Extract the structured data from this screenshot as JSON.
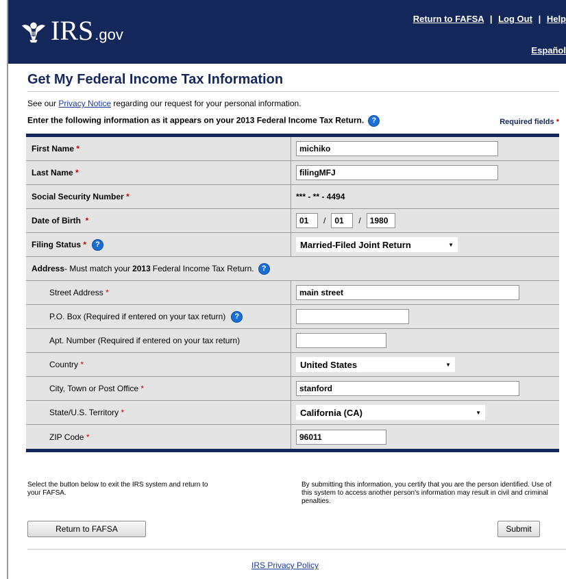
{
  "header": {
    "logo_text": "IRS",
    "logo_suffix": ".gov",
    "links": [
      "Return to FAFSA",
      "Log Out",
      "Help"
    ],
    "espanol": "Español"
  },
  "page": {
    "title": "Get My Federal Income Tax Information",
    "privacy_prefix": "See our ",
    "privacy_link": "Privacy Notice",
    "privacy_suffix": " regarding our request for your personal information.",
    "instruction": "Enter the following information as it appears on your 2013 Federal Income Tax Return.",
    "required_fields": "Required fields",
    "required_marker": "*"
  },
  "form": {
    "first_name": {
      "label": "First Name",
      "value": "michiko"
    },
    "last_name": {
      "label": "Last Name",
      "value": "filingMFJ"
    },
    "ssn": {
      "label": "Social Security Number",
      "value": "*** - ** - 4494"
    },
    "dob": {
      "label": "Date of Birth",
      "month": "01",
      "day": "01",
      "year": "1980",
      "sep": "/"
    },
    "filing_status": {
      "label": "Filing Status",
      "value": "Married-Filed Joint Return"
    },
    "address_header": {
      "label": "Address",
      "middle": " - Must match your ",
      "year": "2013",
      "rest": " Federal Income Tax Return."
    },
    "street": {
      "label": "Street Address",
      "value": "main street"
    },
    "po_box": {
      "label": "P.O. Box (Required if entered on your tax return)",
      "value": ""
    },
    "apt": {
      "label": "Apt. Number (Required if entered on your tax return)",
      "value": ""
    },
    "country": {
      "label": "Country",
      "value": "United States"
    },
    "city": {
      "label": "City, Town or Post Office",
      "value": "stanford"
    },
    "state": {
      "label": "State/U.S. Territory",
      "value": "California (CA)"
    },
    "zip": {
      "label": "ZIP Code",
      "value": "96011"
    }
  },
  "notes": {
    "left": "Select the button below to exit the IRS system and return to your FAFSA.",
    "right": "By submitting this information, you certify that you are the person identified. Use of this system to access another person's information may result in civil and criminal penalties."
  },
  "buttons": {
    "return": "Return to FAFSA",
    "submit": "Submit"
  },
  "footer": {
    "privacy_policy": "IRS Privacy Policy"
  },
  "icons": {
    "help": "?",
    "dropdown": "▼"
  }
}
